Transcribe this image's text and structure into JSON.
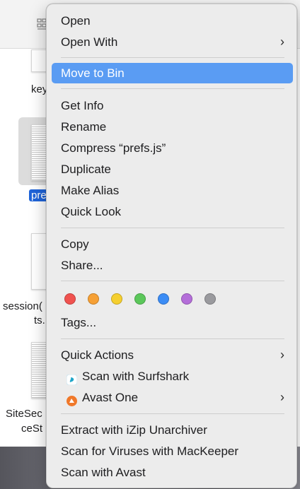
{
  "finder": {
    "files": [
      {
        "label": "key"
      },
      {
        "label": "pre"
      },
      {
        "label_line1": "session(",
        "label_line2": "ts."
      },
      {
        "label_line1": "SiteSec",
        "label_line2": "ceSt"
      }
    ]
  },
  "menu": {
    "group1": [
      {
        "label": "Open",
        "submenu": false
      },
      {
        "label": "Open With",
        "submenu": true
      }
    ],
    "highlighted": {
      "label": "Move to Bin"
    },
    "group2": [
      {
        "label": "Get Info"
      },
      {
        "label": "Rename"
      },
      {
        "label": "Compress “prefs.js”"
      },
      {
        "label": "Duplicate"
      },
      {
        "label": "Make Alias"
      },
      {
        "label": "Quick Look"
      }
    ],
    "group3": [
      {
        "label": "Copy"
      },
      {
        "label": "Share..."
      }
    ],
    "tag_colors": [
      {
        "name": "red",
        "color": "#f0524f"
      },
      {
        "name": "orange",
        "color": "#f6a035"
      },
      {
        "name": "yellow",
        "color": "#f5cf2f"
      },
      {
        "name": "green",
        "color": "#5bc75a"
      },
      {
        "name": "blue",
        "color": "#3b8cf5"
      },
      {
        "name": "purple",
        "color": "#b46ed9"
      },
      {
        "name": "gray",
        "color": "#9a9a9e"
      }
    ],
    "tags_label": "Tags...",
    "group4": [
      {
        "label": "Quick Actions",
        "submenu": true
      },
      {
        "label": "Scan with Surfshark",
        "icon": "surfshark-icon",
        "submenu": false
      },
      {
        "label": "Avast One",
        "icon": "avast-icon",
        "submenu": true
      }
    ],
    "group5": [
      {
        "label": "Extract with iZip Unarchiver"
      },
      {
        "label": "Scan for Viruses with MacKeeper"
      },
      {
        "label": "Scan with Avast"
      }
    ],
    "chevron": "›"
  }
}
